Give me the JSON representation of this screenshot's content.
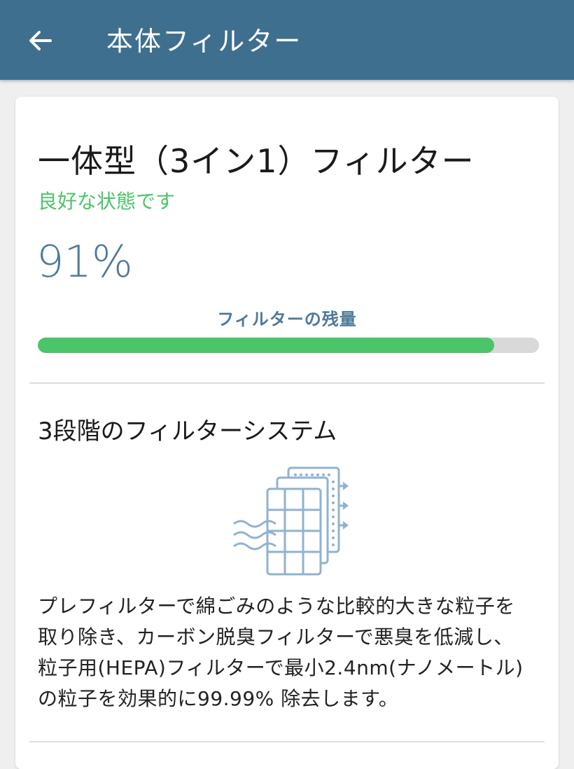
{
  "header": {
    "title": "本体フィルター",
    "back_icon": "arrow-left-icon",
    "background_color": "#3f6f8f"
  },
  "filter": {
    "name": "一体型（3イン1）フィルター",
    "status": "良好な状態です",
    "status_color": "#4cc46a",
    "remaining_percent_text": "91%",
    "remaining_fraction": 0.91,
    "remaining_label": "フィルターの残量"
  },
  "system": {
    "title": "3段階のフィルターシステム",
    "illustration_icon": "three-layer-filter-icon",
    "description_lines": [
      "プレフィルターで綿ごみのような比較的大きな粒子を",
      "取り除き、カーボン脱臭フィルターで悪臭を低減し、",
      "粒子用(HEPA)フィルターで最小2.4nm(ナノメートル)",
      "の粒子を効果的に99.99% 除去します。"
    ]
  }
}
